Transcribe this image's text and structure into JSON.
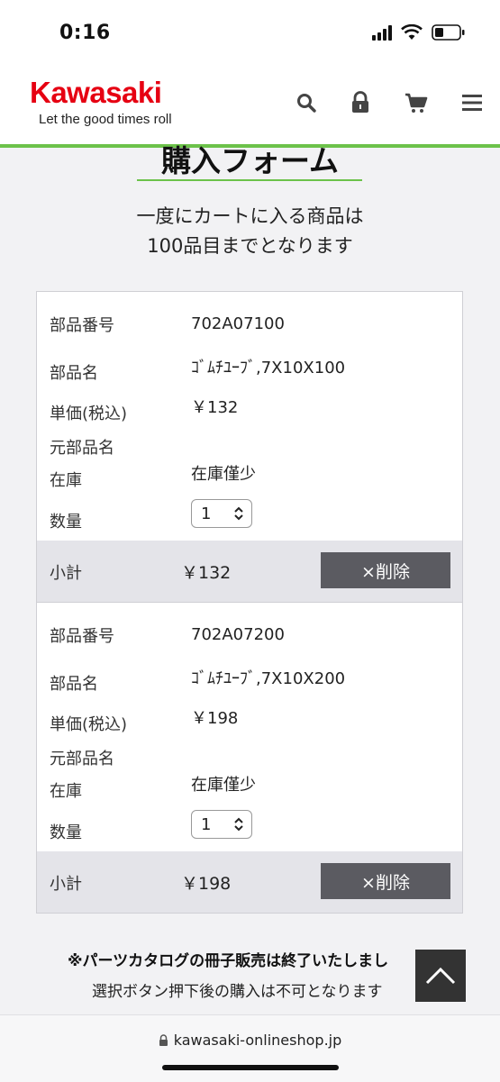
{
  "status_bar": {
    "time": "0:16"
  },
  "header": {
    "logo": "Kawasaki",
    "tagline": "Let the good times roll",
    "icons": [
      "search-icon",
      "lock-icon",
      "cart-icon",
      "menu-icon"
    ]
  },
  "page": {
    "title": "購入フォーム",
    "notice_line1": "一度にカートに入る商品は",
    "notice_line2": "100品目までとなります"
  },
  "labels": {
    "part_number": "部品番号",
    "part_name": "部品名",
    "unit_price": "単価(税込)",
    "original_name": "元部品名",
    "stock": "在庫",
    "quantity": "数量",
    "subtotal": "小計",
    "delete": "×削除"
  },
  "items": [
    {
      "part_number": "702A07100",
      "part_name": "ｺﾞﾑﾁﾕｰﾌﾞ,7X10X100",
      "unit_price": "￥132",
      "original_name": "",
      "stock": "在庫僅少",
      "quantity": "1",
      "subtotal": "￥132"
    },
    {
      "part_number": "702A07200",
      "part_name": "ｺﾞﾑﾁﾕｰﾌﾞ,7X10X200",
      "unit_price": "￥198",
      "original_name": "",
      "stock": "在庫僅少",
      "quantity": "1",
      "subtotal": "￥198"
    }
  ],
  "footer": {
    "catalog_note": "※パーツカタログの冊子販売は終了いたしまし",
    "catalog_sub": "選択ボタン押下後の購入は不可となります"
  },
  "browser": {
    "url": "kawasaki-onlineshop.jp"
  },
  "colors": {
    "brand_red": "#e60012",
    "accent_green": "#6cc24a",
    "button_gray": "#5b5b61"
  }
}
